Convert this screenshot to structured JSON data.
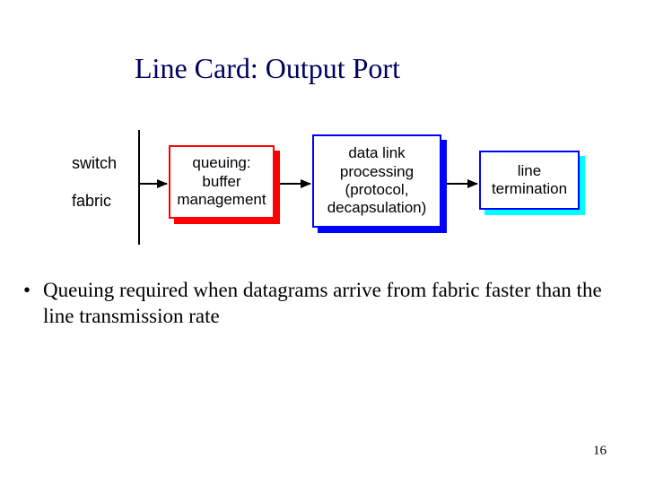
{
  "title": "Line Card: Output Port",
  "diagram": {
    "switch_label_line1": "switch",
    "switch_label_line2": "fabric",
    "boxes": {
      "queuing": {
        "line1": "queuing:",
        "line2": "buffer",
        "line3": "management"
      },
      "datalink": {
        "line1": "data link",
        "line2": "processing",
        "line3": "(protocol,",
        "line4": "decapsulation)"
      },
      "line_term": {
        "line1": "line",
        "line2": "termination"
      }
    },
    "colors": {
      "shadow_red": "#ff0000",
      "border_red": "#ff0000",
      "shadow_blue": "#0000ff",
      "border_blue": "#0000ff",
      "shadow_cyan": "#00ffff",
      "border_cyan": "#0000ff"
    }
  },
  "bullet": "Queuing required when datagrams arrive from fabric faster than the line transmission rate",
  "page_number": "16"
}
